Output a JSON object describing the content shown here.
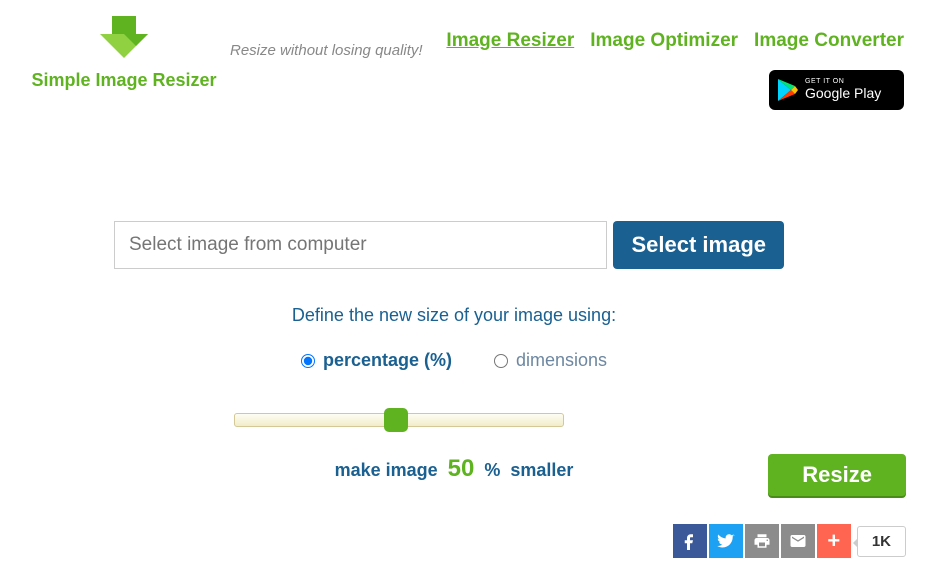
{
  "header": {
    "logo_text": "Simple Image Resizer",
    "tagline": "Resize without losing quality!",
    "nav": {
      "resizer": "Image Resizer",
      "optimizer": "Image Optimizer",
      "converter": "Image Converter"
    },
    "google_play": {
      "small": "GET IT ON",
      "large": "Google Play"
    }
  },
  "main": {
    "file_placeholder": "Select image from computer",
    "select_btn": "Select image",
    "define_label": "Define the new size of your image using:",
    "radio": {
      "percentage": "percentage (%)",
      "dimensions": "dimensions"
    },
    "make_image": "make image",
    "percent_value": "50",
    "percent_sign": "%",
    "smaller": "smaller",
    "resize_btn": "Resize",
    "share_count": "1K"
  }
}
